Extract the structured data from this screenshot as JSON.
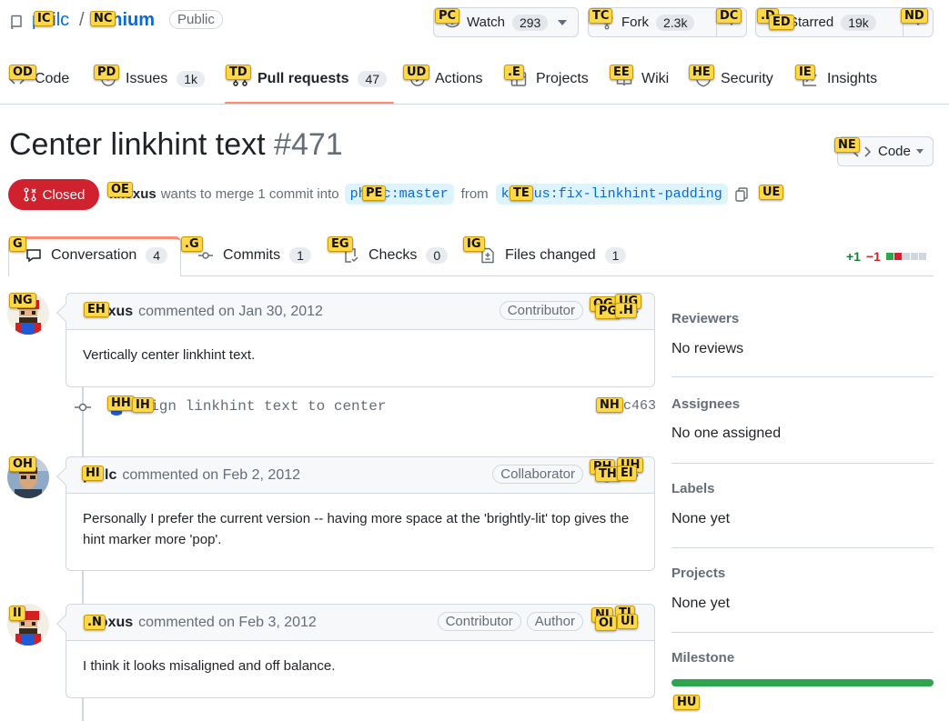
{
  "repo": {
    "owner": "philc",
    "name": "vimium",
    "visibility": "Public"
  },
  "header_buttons": {
    "watch": {
      "label": "Watch",
      "count": "293"
    },
    "fork": {
      "label": "Fork",
      "count": "2.3k"
    },
    "star": {
      "label": "Starred",
      "count": "19k"
    }
  },
  "nav": [
    {
      "label": "Code",
      "icon": "code-icon"
    },
    {
      "label": "Issues",
      "count": "1k",
      "icon": "issue-icon"
    },
    {
      "label": "Pull requests",
      "count": "47",
      "icon": "pull-request-icon"
    },
    {
      "label": "Actions",
      "icon": "play-icon"
    },
    {
      "label": "Projects",
      "icon": "table-icon"
    },
    {
      "label": "Wiki",
      "icon": "book-icon"
    },
    {
      "label": "Security",
      "icon": "shield-icon"
    },
    {
      "label": "Insights",
      "icon": "graph-icon"
    }
  ],
  "pr": {
    "title": "Center linkhint text",
    "number": "#471",
    "state": "Closed",
    "author": "kkoxus",
    "merge_text": "wants to merge 1 commit into",
    "from_text": "from",
    "base_branch": "philc:master",
    "head_branch": "kkoxus:fix-linkhint-padding",
    "code_button": "Code"
  },
  "tabs": [
    {
      "label": "Conversation",
      "count": "4"
    },
    {
      "label": "Commits",
      "count": "1"
    },
    {
      "label": "Checks",
      "count": "0"
    },
    {
      "label": "Files changed",
      "count": "1"
    }
  ],
  "diffstat": {
    "added": "+1",
    "removed": "−1"
  },
  "comments": [
    {
      "author": "kkoxus",
      "meta": "commented on Jan 30, 2012",
      "roles": [
        "Contributor"
      ],
      "body": "Vertically center linkhint text."
    },
    {
      "author": "philc",
      "meta": "commented on Feb 2, 2012",
      "roles": [
        "Collaborator"
      ],
      "body": "Personally I prefer the current version -- having more space at the 'brightly-lit' top gives the hint marker more 'pop'."
    },
    {
      "author": "kkoxus",
      "meta": "commented on Feb 3, 2012",
      "roles": [
        "Contributor",
        "Author"
      ],
      "body": "I think it looks misaligned and off balance."
    }
  ],
  "commit": {
    "message": "Align linkhint text to center",
    "sha": "8c463"
  },
  "sidebar": {
    "reviewers": {
      "title": "Reviewers",
      "value": "No reviews"
    },
    "assignees": {
      "title": "Assignees",
      "value": "No one assigned"
    },
    "labels": {
      "title": "Labels",
      "value": "None yet"
    },
    "projects": {
      "title": "Projects",
      "value": "None yet"
    },
    "milestone": {
      "title": "Milestone",
      "progress": 1.0
    }
  },
  "hints": {
    "owner": "IC",
    "repo": "NC",
    "watch": "PC",
    "fork": "TC",
    "fork_drop": "DC",
    "star_icon": ".D",
    "star": "ED",
    "star_drop": "ND",
    "nav_code": "OD",
    "nav_issues": "PD",
    "nav_prs": "TD",
    "nav_actions": "UD",
    "nav_projects": ".E",
    "nav_wiki": "EE",
    "nav_security": "HE",
    "nav_insights": "IE",
    "code_btn": "NE",
    "author_link": "OE",
    "base_branch": "PE",
    "head_branch": "TE",
    "copy_branch": "UE",
    "tab_conv": "G",
    "tab_commits": ".G",
    "tab_checks": "EG",
    "tab_files": "IG",
    "avatar1": "NG",
    "author1": "EH",
    "react1a": "OG",
    "react1b": "UG",
    "react1c": "PG",
    "react1d": ".H",
    "commit_avatar": "HH",
    "commit_msg": "IH",
    "commit_sha": "NH",
    "avatar2": "OH",
    "author2": "HI",
    "react2a": "PH",
    "react2b": "UH",
    "react2c": "TH",
    "react2d": "EI",
    "avatar3": "II",
    "author3": ".N",
    "react3a": "NI",
    "react3b": "TI",
    "react3c": "OI",
    "react3d": "UI",
    "milestone": "HU"
  },
  "colors": {
    "link": "#0969da",
    "closed": "#cf222e",
    "accent_underline": "#fd8c73",
    "progress": "#2da44e"
  }
}
